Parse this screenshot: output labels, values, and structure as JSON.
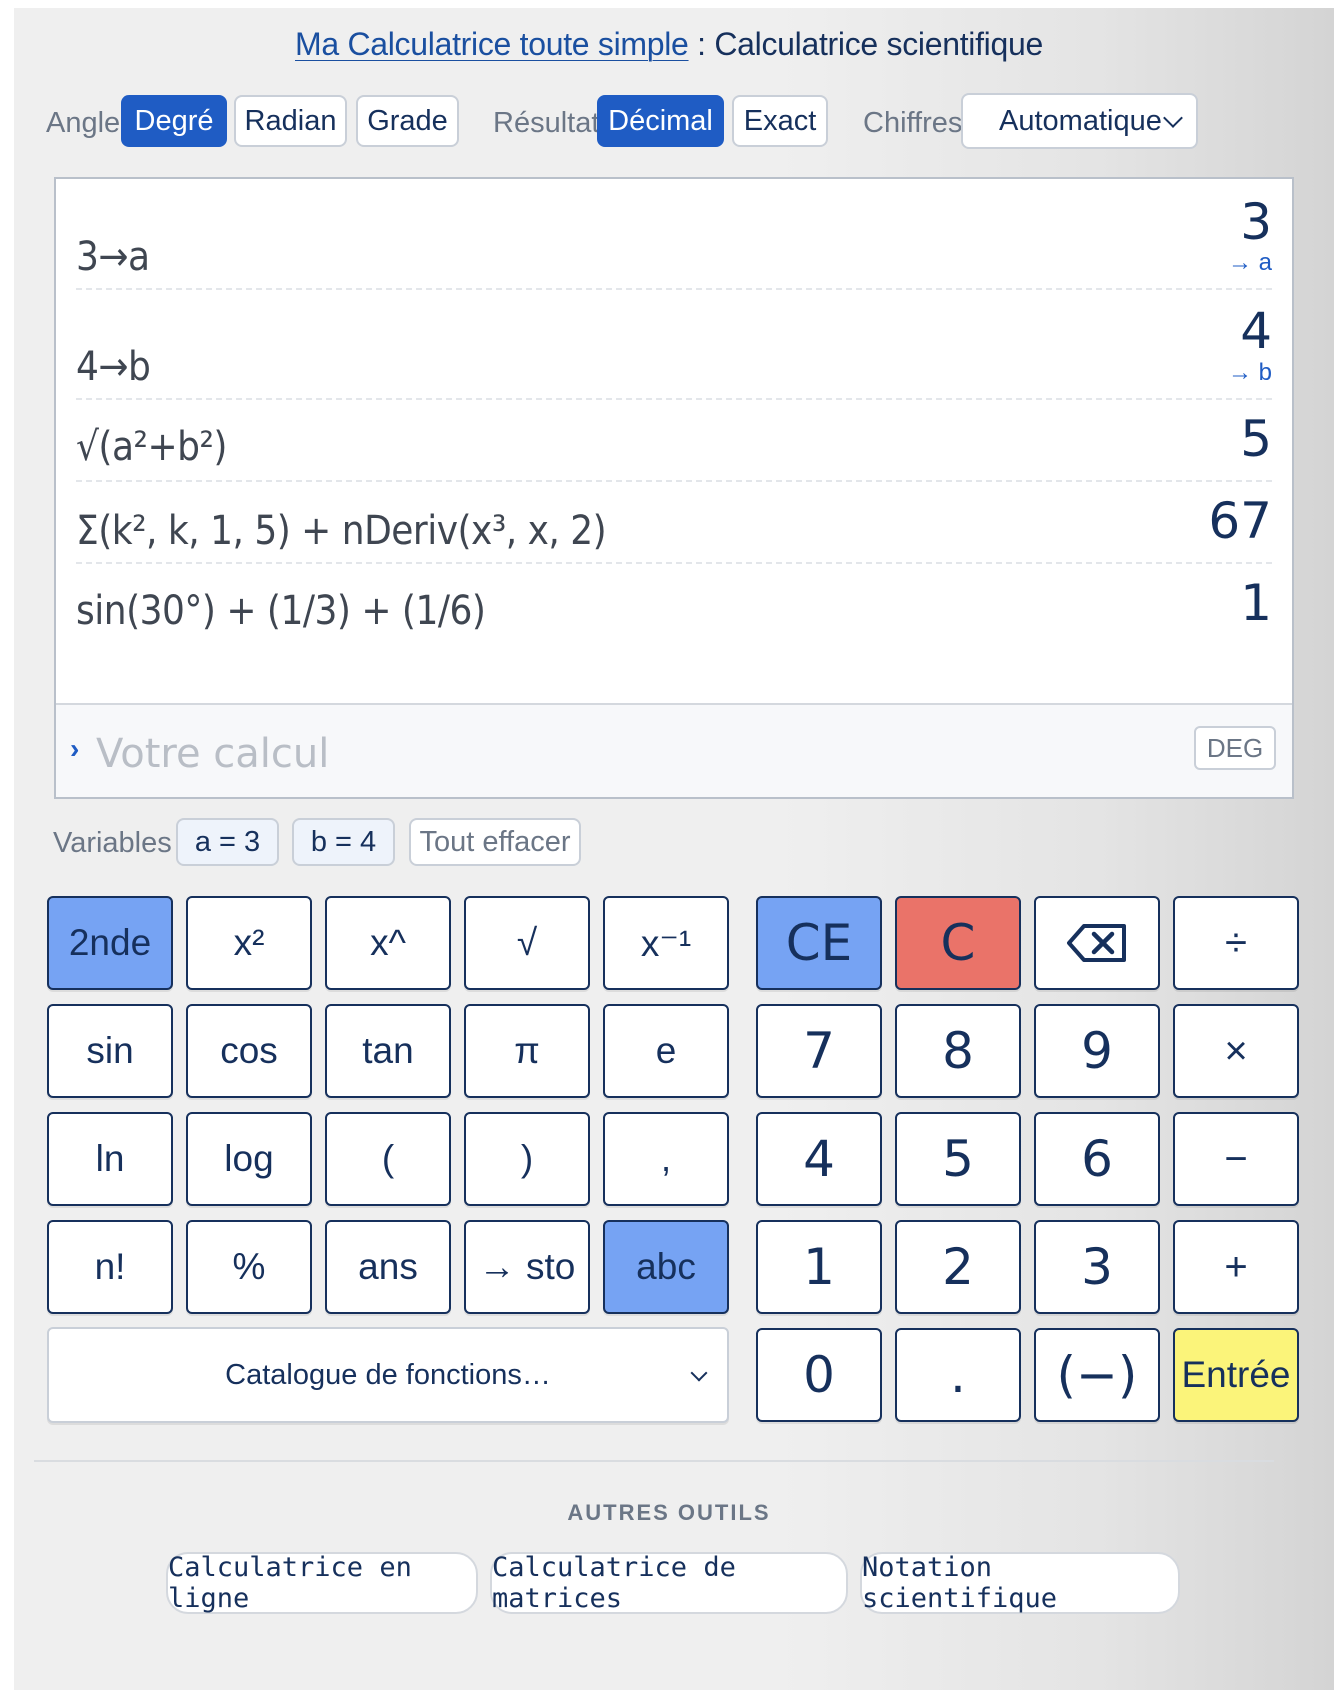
{
  "title": {
    "link_text": "Ma Calculatrice toute simple",
    "separator": " : ",
    "main": "Calculatrice scientifique"
  },
  "options": {
    "angle_label": "Angle",
    "angle_modes": [
      "Degré",
      "Radian",
      "Grade"
    ],
    "angle_selected": "Degré",
    "result_label": "Résultat",
    "result_modes": [
      "Décimal",
      "Exact"
    ],
    "result_selected": "Décimal",
    "digits_label": "Chiffres",
    "digits_value": "Automatique"
  },
  "history": [
    {
      "expr": "3→a",
      "result": "3",
      "store": "→ a"
    },
    {
      "expr": "4→b",
      "result": "4",
      "store": "→ b"
    },
    {
      "expr": "√(a²+b²)",
      "result": "5",
      "store": ""
    },
    {
      "expr": "Σ(k², k, 1, 5) + nDeriv(x³, x, 2)",
      "result": "67",
      "store": ""
    },
    {
      "expr": "sin(30°) + (1/3) + (1/6)",
      "result": "1",
      "store": ""
    }
  ],
  "input": {
    "prompt": "›",
    "placeholder": "Votre calcul",
    "mode_badge": "DEG"
  },
  "variables": {
    "label": "Variables",
    "items": [
      "a = 3",
      "b = 4"
    ],
    "clear_label": "Tout effacer"
  },
  "keypad": {
    "func": [
      [
        "2nde",
        "x²",
        "x^",
        "√",
        "x⁻¹"
      ],
      [
        "sin",
        "cos",
        "tan",
        "π",
        "e"
      ],
      [
        "ln",
        "log",
        "(",
        ")",
        ","
      ],
      [
        "n!",
        "%",
        "ans",
        "→ sto",
        "abc"
      ]
    ],
    "num": [
      [
        "CE",
        "C",
        "backspace-icon",
        "÷"
      ],
      [
        "7",
        "8",
        "9",
        "×"
      ],
      [
        "4",
        "5",
        "6",
        "−"
      ],
      [
        "1",
        "2",
        "3",
        "+"
      ],
      [
        "0",
        ".",
        "(−)",
        "Entrée"
      ]
    ],
    "catalog_label": "Catalogue de fonctions…"
  },
  "other_tools": {
    "title": "AUTRES OUTILS",
    "items": [
      "Calculatrice en ligne",
      "Calculatrice de matrices",
      "Notation scientifique"
    ]
  },
  "colors": {
    "primary": "#1f5cc4",
    "text": "#16305c",
    "key_blue": "#76a3f3",
    "key_red": "#ea7369",
    "key_yellow": "#fbf47a"
  }
}
